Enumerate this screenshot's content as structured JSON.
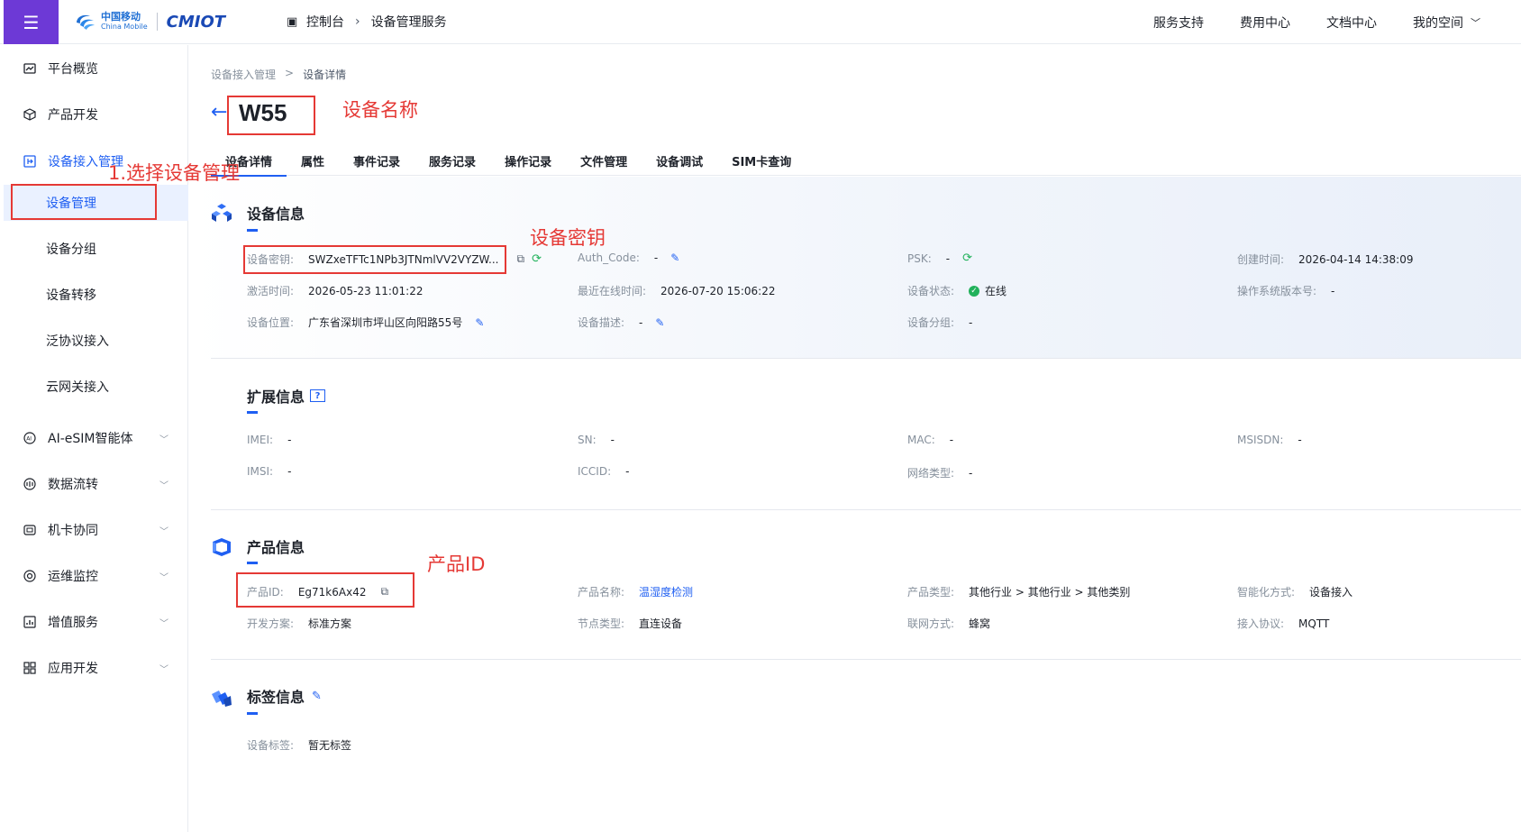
{
  "topbar": {
    "menu_icon": "menu-icon",
    "logo_cn": "中国移动",
    "logo_en": "China Mobile",
    "logo_brand": "CMIOT",
    "breadcrumb": [
      "控制台",
      "设备管理服务"
    ],
    "links": [
      "服务支持",
      "费用中心",
      "文档中心"
    ],
    "my_space": "我的空间"
  },
  "sidebar": {
    "items": [
      {
        "label": "平台概览",
        "icon": "dashboard-icon"
      },
      {
        "label": "产品开发",
        "icon": "box-icon"
      },
      {
        "label": "设备接入管理",
        "icon": "device-access-icon"
      },
      {
        "label": "AI-eSIM智能体",
        "icon": "ai-icon"
      },
      {
        "label": "数据流转",
        "icon": "data-flow-icon"
      },
      {
        "label": "机卡协同",
        "icon": "sim-icon"
      },
      {
        "label": "运维监控",
        "icon": "monitor-icon"
      },
      {
        "label": "增值服务",
        "icon": "chart-icon"
      },
      {
        "label": "应用开发",
        "icon": "apps-icon"
      }
    ],
    "subitems": [
      "设备管理",
      "设备分组",
      "设备转移",
      "泛协议接入",
      "云网关接入"
    ]
  },
  "page": {
    "breadcrumb": [
      "设备接入管理",
      "设备详情"
    ],
    "device_name": "W55",
    "tabs": [
      "设备详情",
      "属性",
      "事件记录",
      "服务记录",
      "操作记录",
      "文件管理",
      "设备调试",
      "SIM卡查询"
    ],
    "active_tab": "设备详情"
  },
  "device_info": {
    "title": "设备信息",
    "fields": {
      "key_label": "设备密钥:",
      "key_value": "SWZxeTFTc1NPb3JTNmlVV2VYZW...",
      "auth_label": "Auth_Code:",
      "auth_value": "-",
      "psk_label": "PSK:",
      "psk_value": "-",
      "created_label": "创建时间:",
      "created_value": "2026-04-14 14:38:09",
      "activated_label": "激活时间:",
      "activated_value": "2026-05-23 11:01:22",
      "online_label": "最近在线时间:",
      "online_value": "2026-07-20 15:06:22",
      "status_label": "设备状态:",
      "status_value": "在线",
      "os_label": "操作系统版本号:",
      "os_value": "-",
      "location_label": "设备位置:",
      "location_value": "广东省深圳市坪山区向阳路55号",
      "desc_label": "设备描述:",
      "desc_value": "-",
      "group_label": "设备分组:",
      "group_value": "-"
    }
  },
  "ext_info": {
    "title": "扩展信息",
    "help": "?",
    "fields": {
      "imei_label": "IMEI:",
      "imei_value": "-",
      "sn_label": "SN:",
      "sn_value": "-",
      "mac_label": "MAC:",
      "mac_value": "-",
      "msisdn_label": "MSISDN:",
      "msisdn_value": "-",
      "imsi_label": "IMSI:",
      "imsi_value": "-",
      "iccid_label": "ICCID:",
      "iccid_value": "-",
      "net_label": "网络类型:",
      "net_value": "-"
    }
  },
  "product_info": {
    "title": "产品信息",
    "fields": {
      "pid_label": "产品ID:",
      "pid_value": "Eg71k6Ax42",
      "pname_label": "产品名称:",
      "pname_value": "温湿度检测",
      "ptype_label": "产品类型:",
      "ptype_value": "其他行业 > 其他行业 > 其他类别",
      "smart_label": "智能化方式:",
      "smart_value": "设备接入",
      "dev_label": "开发方案:",
      "dev_value": "标准方案",
      "node_label": "节点类型:",
      "node_value": "直连设备",
      "conn_label": "联网方式:",
      "conn_value": "蜂窝",
      "proto_label": "接入协议:",
      "proto_value": "MQTT"
    }
  },
  "tag_info": {
    "title": "标签信息",
    "tag_label": "设备标签:",
    "tag_value": "暂无标签"
  },
  "annotations": {
    "device_name": "设备名称",
    "select_device_mgmt": "1.选择设备管理",
    "device_key": "设备密钥",
    "product_id": "产品ID",
    "color": "#e53935"
  },
  "colors": {
    "accent": "#1f5ff2",
    "menu_bg": "#6d39d6",
    "online": "#21b15b"
  }
}
